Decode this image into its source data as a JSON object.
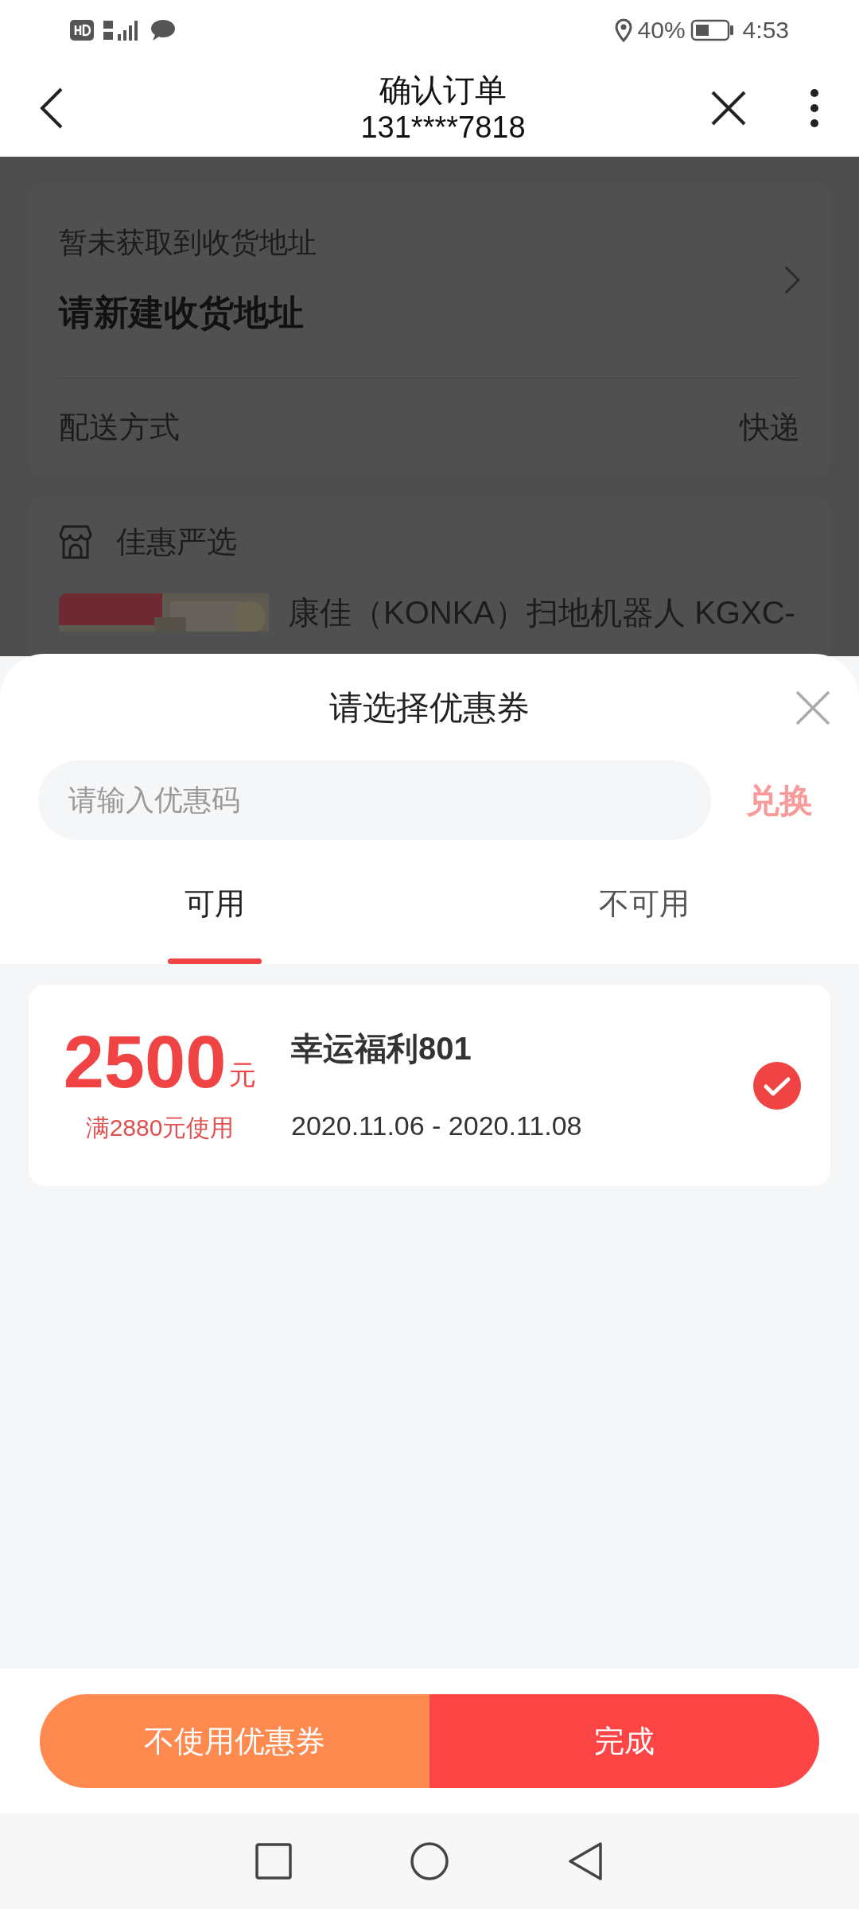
{
  "status_bar": {
    "battery": "40%",
    "time": "4:53"
  },
  "header": {
    "title": "确认订单",
    "subtitle": "131****7818"
  },
  "address": {
    "hint": "暂未获取到收货地址",
    "action": "请新建收货地址"
  },
  "delivery": {
    "label": "配送方式",
    "value": "快递"
  },
  "store": {
    "name": "佳惠严选"
  },
  "product": {
    "kind": "picture",
    "title": "康佳（KONKA）扫地机器人 KGXC-"
  },
  "coupon_sheet": {
    "title": "请选择优惠券",
    "code_field": {
      "placeholder": "请输入优惠码"
    },
    "redeem": "兑换",
    "tabs": [
      {
        "label": "可用",
        "selected": true
      },
      {
        "label": "不可用",
        "selected": false
      }
    ],
    "coupons": [
      {
        "amount": "2500",
        "unit": "元",
        "condition": "满2880元使用",
        "name": "幸运福利801",
        "validity": "2020.11.06 - 2020.11.08",
        "selected": true
      }
    ]
  },
  "buttons": [
    {
      "label": "不使用优惠券",
      "kind": "secondary"
    },
    {
      "label": "完成",
      "kind": "primary"
    }
  ]
}
